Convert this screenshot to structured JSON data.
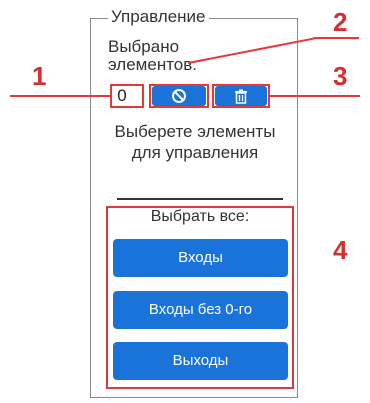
{
  "panel": {
    "legend": "Управление",
    "selected_label": "Выбрано элементов:",
    "selected_count": "0",
    "hint": "Выберете элементы для управления",
    "select_all_label": "Выбрать все:",
    "buttons": {
      "inputs": "Входы",
      "inputs_without_zero": "Входы без 0-го",
      "outputs": "Выходы"
    },
    "icons": {
      "clear": "clear-selection-icon",
      "delete": "trash-icon"
    }
  },
  "annotations": {
    "labels": [
      "1",
      "2",
      "3",
      "4"
    ]
  },
  "colors": {
    "accent": "#1a73d9",
    "annotation": "#e53935"
  }
}
